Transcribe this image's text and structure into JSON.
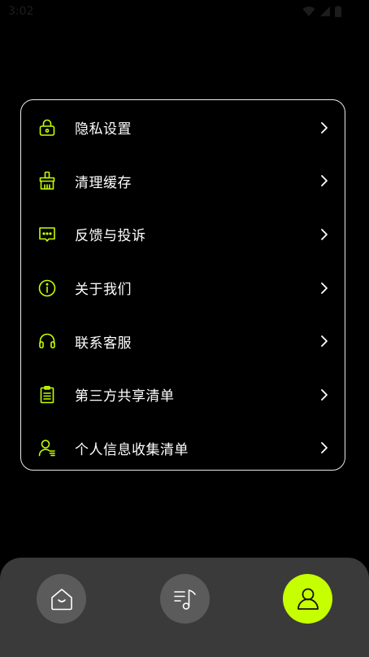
{
  "status_bar": {
    "time": "3:02",
    "icons": [
      "wifi-icon",
      "signal-icon",
      "battery-icon"
    ]
  },
  "settings_menu": {
    "items": [
      {
        "label": "隐私设置",
        "icon": "lock-icon"
      },
      {
        "label": "清理缓存",
        "icon": "broom-icon"
      },
      {
        "label": "反馈与投诉",
        "icon": "message-icon"
      },
      {
        "label": "关于我们",
        "icon": "info-icon"
      },
      {
        "label": "联系客服",
        "icon": "headset-icon"
      },
      {
        "label": "第三方共享清单",
        "icon": "clipboard-icon"
      },
      {
        "label": "个人信息收集清单",
        "icon": "user-list-icon"
      }
    ]
  },
  "bottom_nav": {
    "items": [
      {
        "icon": "home-icon",
        "active": false
      },
      {
        "icon": "music-list-icon",
        "active": false
      },
      {
        "icon": "profile-icon",
        "active": true
      }
    ]
  },
  "colors": {
    "accent": "#c6ff00",
    "background": "#000000",
    "nav_bar": "#3a3a3a",
    "nav_button": "#5b5b5b"
  }
}
